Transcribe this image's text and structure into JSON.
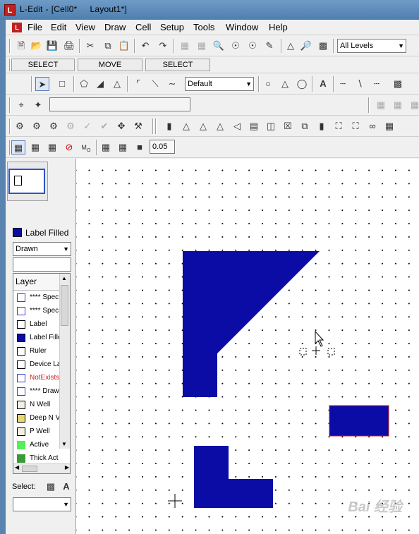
{
  "window": {
    "app_name": "L-Edit",
    "title_cell": "[Cell0*",
    "title_layout": "Layout1*]"
  },
  "menu": [
    "File",
    "Edit",
    "View",
    "Draw",
    "Cell",
    "Setup",
    "Tools",
    "Window",
    "Help"
  ],
  "toolbar_levels": {
    "selected": "All Levels"
  },
  "mouse_buttons": [
    "SELECT",
    "MOVE",
    "SELECT"
  ],
  "drawing_toolbar": {
    "style_select": "Default"
  },
  "grid_toolbar": {
    "value": "0.05"
  },
  "left_panel": {
    "current_layer": "Label Filled",
    "mode_select": "Drawn",
    "layer_header": "Layer",
    "layers": [
      {
        "name": "**** Spec",
        "color": "#ffffff",
        "border": "#3a3ad0"
      },
      {
        "name": "**** Spec",
        "color": "#ffffff",
        "border": "#3a3ad0"
      },
      {
        "name": "Label",
        "color": "#ffffff",
        "border": "#000000"
      },
      {
        "name": "Label Fille",
        "color": "#0b0ba6",
        "border": "#000000"
      },
      {
        "name": "Ruler",
        "color": "#ffffff",
        "border": "#000000"
      },
      {
        "name": "Device La",
        "color": "#ffffff",
        "border": "#000000"
      },
      {
        "name": "NotExists",
        "color": "#ffffff",
        "border": "#3a3ad0",
        "text_color": "#d02020"
      },
      {
        "name": "**** Draw",
        "color": "#ffffff",
        "border": "#3a3ad0"
      },
      {
        "name": "N Well",
        "color": "#f3f0e6",
        "border": "#000000"
      },
      {
        "name": "Deep N V",
        "color": "#e8d870",
        "border": "#000000"
      },
      {
        "name": "P Well",
        "color": "#f5f0e0",
        "border": "#000000"
      },
      {
        "name": "Active",
        "color": "#55ee55",
        "border": "#55ee55"
      },
      {
        "name": "Thick Act",
        "color": "#3a9a3a",
        "border": "#3a9a3a"
      }
    ],
    "select_label": "Select:"
  },
  "canvas": {
    "shape_color": "#0b0ba6",
    "selected_outline": "#c01818"
  },
  "watermark": "Bai 经验"
}
